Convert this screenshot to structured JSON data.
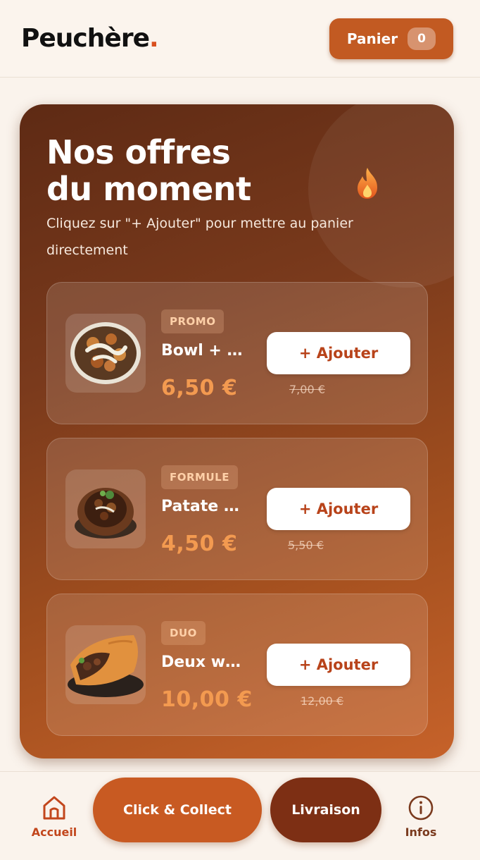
{
  "header": {
    "logo_text": "Peuchère",
    "logo_dot": ".",
    "cart_label": "Panier",
    "cart_count": "0"
  },
  "offers": {
    "title_line1": "Nos offres",
    "title_line2": "du moment",
    "title_icon": "flame-icon",
    "subtitle": "Cliquez sur \"+ Ajouter\" pour mettre au panier directement",
    "items": [
      {
        "badge": "PROMO",
        "name": "Bowl + …",
        "price": "6,50 €",
        "old_price": "7,00 €",
        "button": "+ Ajouter",
        "image": "bowl-image"
      },
      {
        "badge": "FORMULE",
        "name": "Patate …",
        "price": "4,50 €",
        "old_price": "5,50 €",
        "button": "+ Ajouter",
        "image": "stuffed-potato-image"
      },
      {
        "badge": "DUO",
        "name": "Deux w…",
        "price": "10,00 €",
        "old_price": "12,00 €",
        "button": "+ Ajouter",
        "image": "wrap-image"
      }
    ]
  },
  "nav": {
    "home_label": "Accueil",
    "click_collect_label": "Click & Collect",
    "delivery_label": "Livraison",
    "info_label": "Infos",
    "home_icon": "home-icon",
    "info_icon": "info-icon"
  },
  "colors": {
    "accent": "#c25a22",
    "accent_dark": "#7a2f14",
    "price": "#f39a50",
    "background": "#faf3ec"
  }
}
